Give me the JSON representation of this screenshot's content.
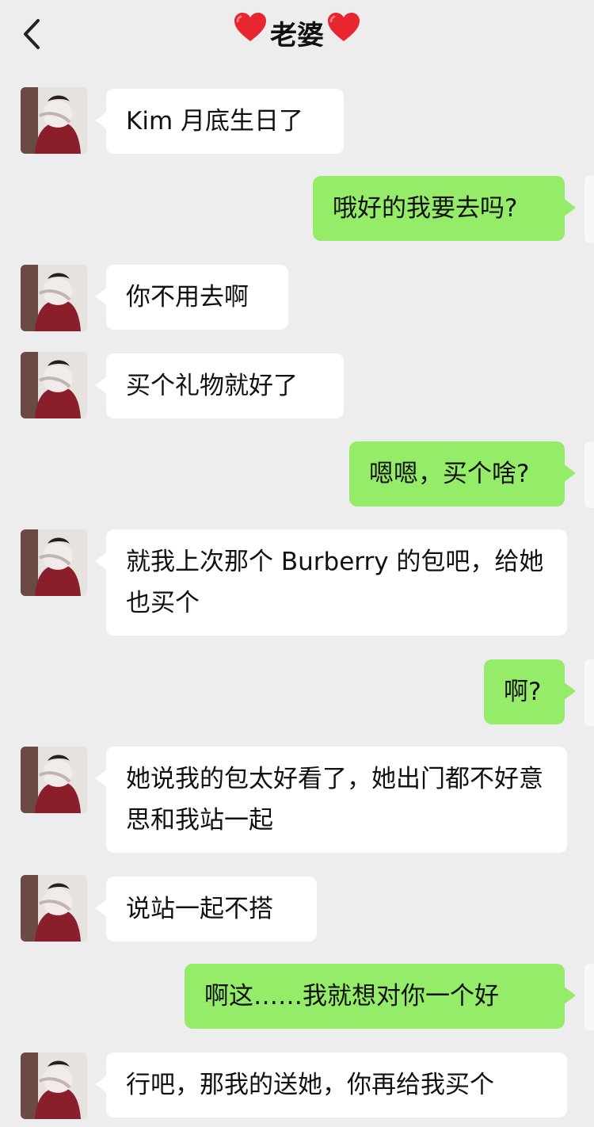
{
  "header": {
    "title": "老婆",
    "back_icon": "chevron-left-icon",
    "title_decoration_icon": "red-heart-icon"
  },
  "colors": {
    "background": "#ededed",
    "incoming_bubble": "#ffffff",
    "outgoing_bubble": "#95ec69"
  },
  "messages": [
    {
      "side": "left",
      "text": "Kim 月底生日了"
    },
    {
      "side": "right",
      "text": "哦好的我要去吗?"
    },
    {
      "side": "left",
      "text": "你不用去啊"
    },
    {
      "side": "left",
      "text": "买个礼物就好了"
    },
    {
      "side": "right",
      "text": "嗯嗯，买个啥?"
    },
    {
      "side": "left",
      "text": "就我上次那个 Burberry 的包吧，给她也买个"
    },
    {
      "side": "right",
      "text": "啊?"
    },
    {
      "side": "left",
      "text": "她说我的包太好看了，她出门都不好意思和我站一起"
    },
    {
      "side": "left",
      "text": "说站一起不搭"
    },
    {
      "side": "right",
      "text": "啊这……我就想对你一个好"
    },
    {
      "side": "left",
      "text": "行吧，那我的送她，你再给我买个"
    }
  ]
}
